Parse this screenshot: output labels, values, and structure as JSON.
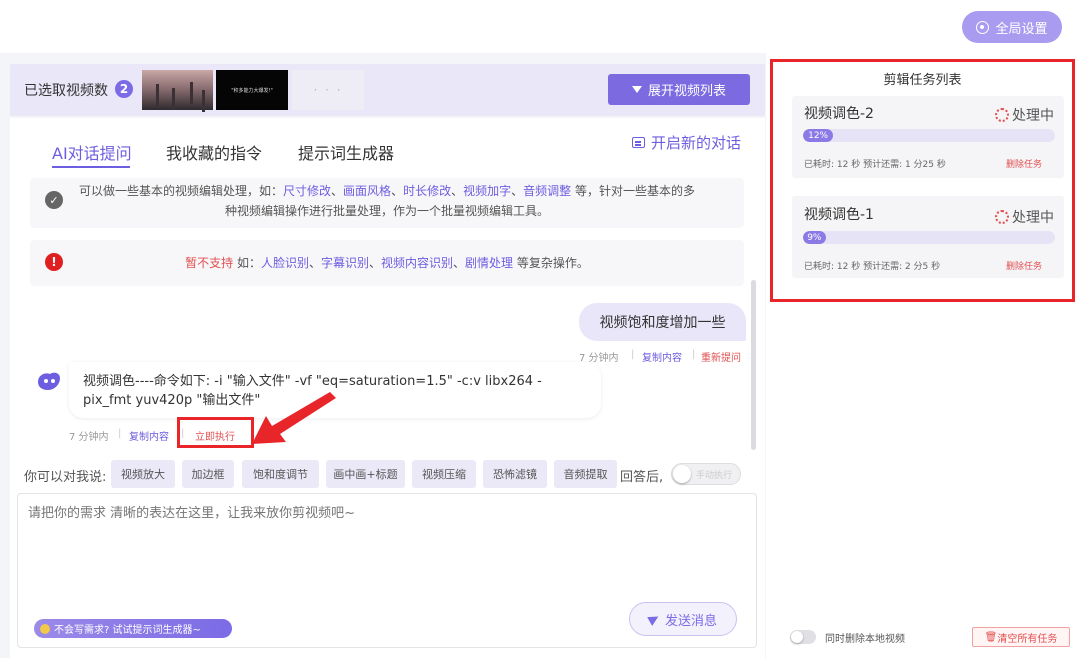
{
  "header": {
    "global_settings_label": "全局设置"
  },
  "video_strip": {
    "label": "已选取视频数",
    "count": "2",
    "thumb2_caption": "\"积多能力大爆发!\"",
    "thumb3_placeholder": "· · ·",
    "expand_label": "展开视频列表"
  },
  "tabs": [
    {
      "label": "AI对话提问",
      "active": true
    },
    {
      "label": "我收藏的指令",
      "active": false
    },
    {
      "label": "提示词生成器",
      "active": false
    }
  ],
  "new_chat_label": "开启新的对话",
  "info_ok": {
    "prefix": "可以做一些基本的视频编辑处理，如：",
    "links": [
      "尺寸修改",
      "画面风格",
      "时长修改",
      "视频加字",
      "音频调整"
    ],
    "sep": "、",
    "suffix_line1": " 等，针对一些基本的多",
    "line2": "种视频编辑操作进行批量处理，作为一个批量视频编辑工具。"
  },
  "info_warn": {
    "not_supported": "暂不支持",
    "mid": " 如：",
    "links": [
      "人脸识别",
      "字幕识别",
      "视频内容识别",
      "剧情处理"
    ],
    "sep": "、",
    "suffix": " 等复杂操作。"
  },
  "user_message": {
    "text": "视频饱和度增加一些",
    "time": "7 分钟内",
    "copy_label": "复制内容",
    "retry_label": "重新提问"
  },
  "bot_message": {
    "text": "视频调色----命令如下: -i \"输入文件\" -vf \"eq=saturation=1.5\" -c:v libx264 -pix_fmt yuv420p \"输出文件\"",
    "time": "7 分钟内",
    "copy_label": "复制内容",
    "execute_label": "立即执行"
  },
  "suggestions": {
    "label": "你可以对我说:",
    "chips": [
      "视频放大",
      "加边框",
      "饱和度调节",
      "画中画+标题",
      "视频压缩",
      "恐怖滤镜",
      "音频提取"
    ],
    "after_reply": "回答后,",
    "auto_exec_label": "手动执行"
  },
  "composer": {
    "placeholder": "请把你的需求 清晰的表达在这里，让我来放你剪视频吧~",
    "hint_label": "不会写需求? 试试提示词生成器~",
    "send_label": "发送消息"
  },
  "task_panel": {
    "title": "剪辑任务列表",
    "tasks": [
      {
        "name": "视频调色-2",
        "status": "处理中",
        "progress": 12,
        "progress_label": "12%",
        "meta": "已耗时: 12 秒 预计还需: 1 分25 秒",
        "delete_label": "删除任务"
      },
      {
        "name": "视频调色-1",
        "status": "处理中",
        "progress": 9,
        "progress_label": "9%",
        "meta": "已耗时: 12 秒 预计还需: 2 分5 秒",
        "delete_label": "删除任务"
      }
    ]
  },
  "footer": {
    "delete_local_label": "同时删除本地视频",
    "clear_all_label": "清空所有任务"
  },
  "colors": {
    "accent": "#7b6be6",
    "danger": "#e8262a"
  }
}
